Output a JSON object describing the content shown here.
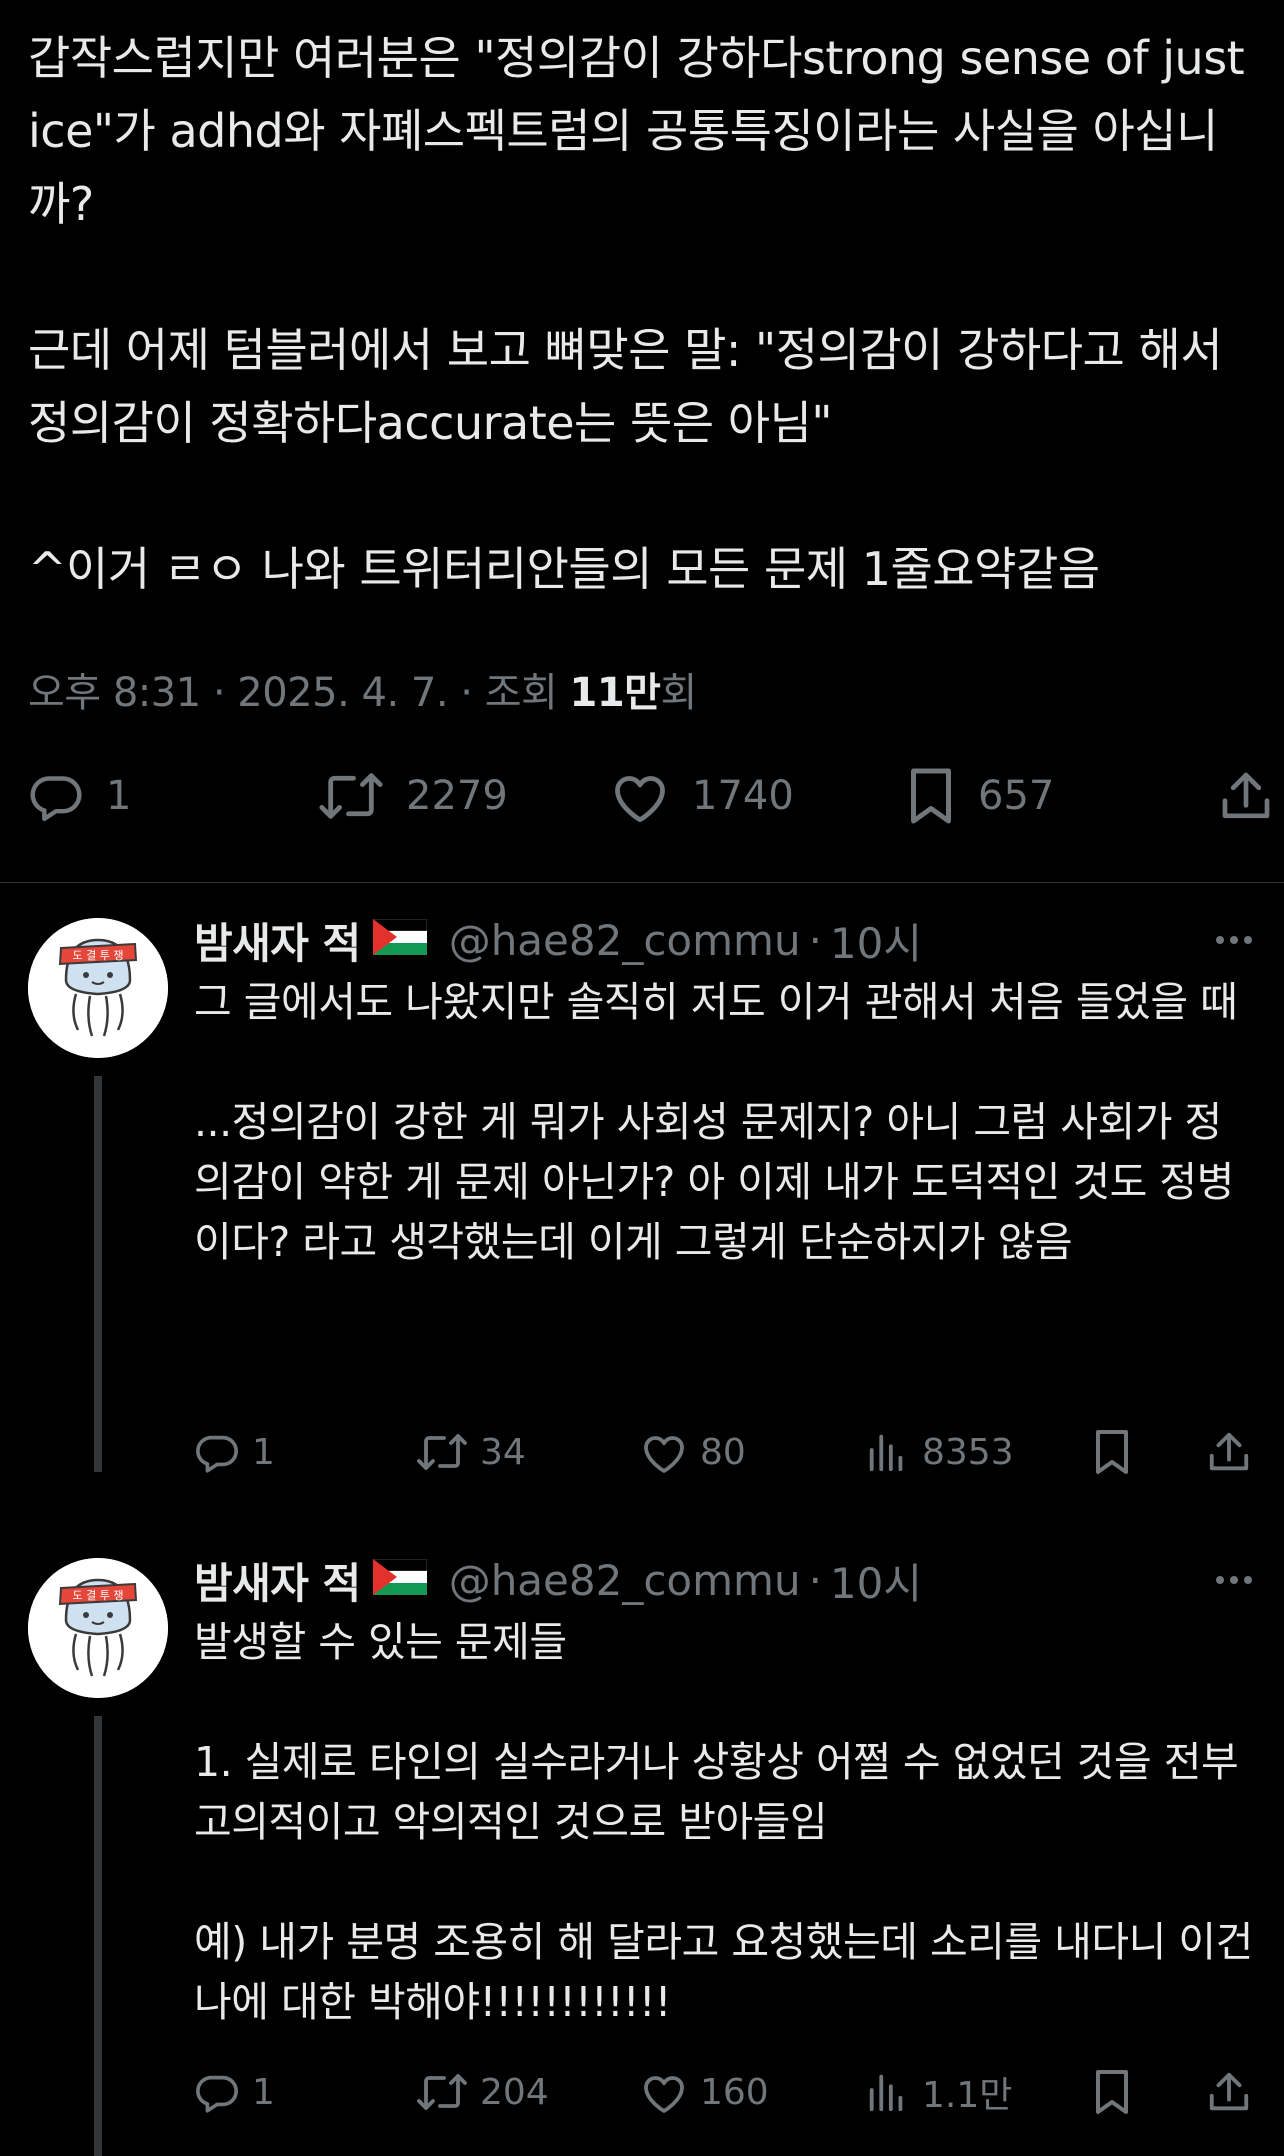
{
  "post": {
    "text": "갑작스럽지만 여러분은 \"정의감이 강하다strong sense of justice\"가 adhd와 자폐스펙트럼의 공통특징이라는 사실을 아십니까?\n\n근데 어제 텀블러에서 보고 뼈맞은 말: \"정의감이 강하다고 해서 정의감이 정확하다accurate는 뜻은 아님\"\n\n^이거 ㄹㅇ 나와 트위터리안들의 모든 문제 1줄요약같음",
    "time_date": "오후 8:31 · 2025. 4. 7. · 조회 ",
    "views_bold": "11만",
    "views_suffix": "회",
    "stats": {
      "replies": "1",
      "reposts": "2279",
      "likes": "1740",
      "bookmarks": "657"
    }
  },
  "replies": [
    {
      "display_name": "밤새자 적",
      "flag_icon": "palestine-flag-icon",
      "handle": "@hae82_commu",
      "dot": "·",
      "time": "10시",
      "text": "그 글에서도 나왔지만 솔직히 저도 이거 관해서 처음 들었을 때\n\n...정의감이 강한 게 뭐가 사회성 문제지? 아니 그럼 사회가 정의감이 약한 게 문제 아닌가? 아 이제 내가 도덕적인 것도 정병이다? 라고 생각했는데 이게 그렇게 단순하지가 않음",
      "stats": {
        "replies": "1",
        "reposts": "34",
        "likes": "80",
        "views": "8353"
      }
    },
    {
      "display_name": "밤새자 적",
      "flag_icon": "palestine-flag-icon",
      "handle": "@hae82_commu",
      "dot": "·",
      "time": "10시",
      "text": "발생할 수 있는 문제들\n\n1. 실제로 타인의 실수라거나 상황상 어쩔 수 없었던 것을 전부 고의적이고 악의적인 것으로 받아들임\n\n예) 내가 분명 조용히 해 달라고 요청했는데 소리를 내다니 이건 나에 대한 박해야!!!!!!!!!!!!",
      "stats": {
        "replies": "1",
        "reposts": "204",
        "likes": "160",
        "views": "1.1만"
      }
    }
  ],
  "colors": {
    "background": "#000000",
    "text": "#e7e9ea",
    "muted": "#71767b",
    "divider": "#2f3336",
    "thread_line": "#333639"
  }
}
